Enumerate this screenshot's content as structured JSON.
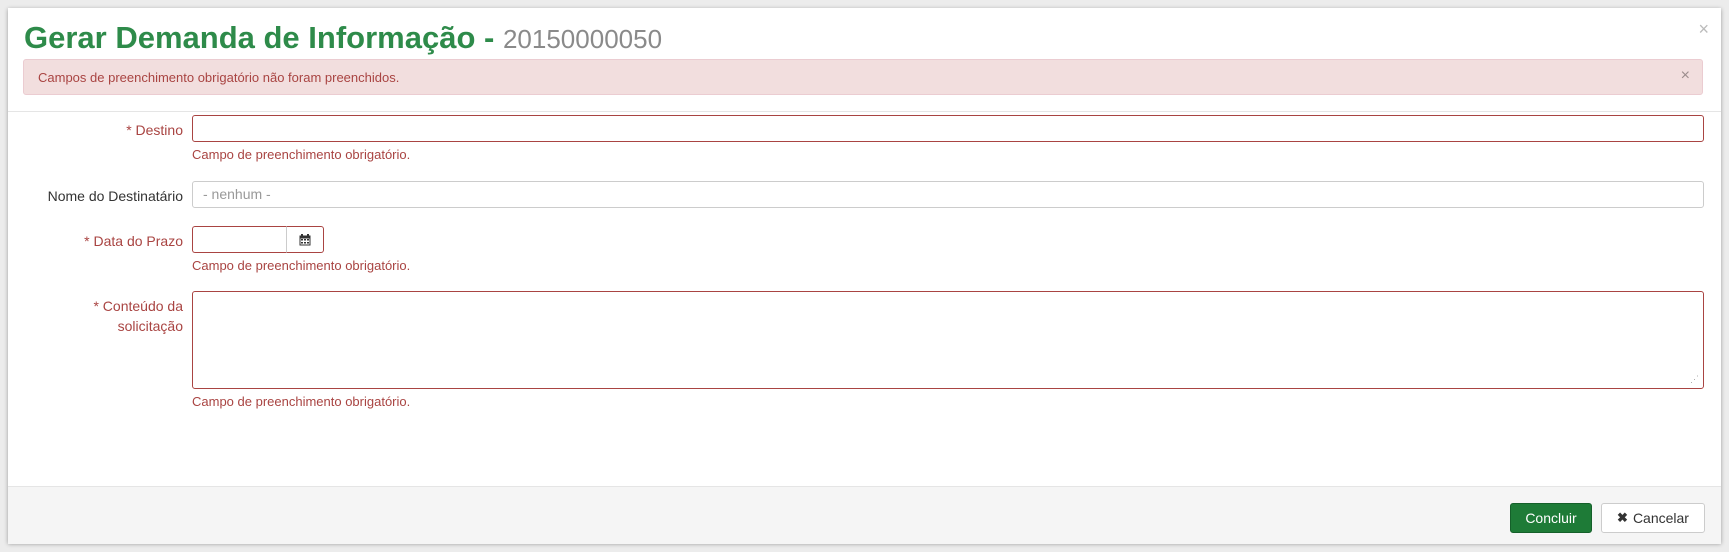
{
  "modal": {
    "title": "Gerar Demanda de Informação",
    "separator": "-",
    "number": "20150000050",
    "close_icon": "×"
  },
  "alert": {
    "message": "Campos de preenchimento obrigatório não foram preenchidos.",
    "close_icon": "×"
  },
  "form": {
    "destino": {
      "label": "* Destino",
      "value": "",
      "error": "Campo de preenchimento obrigatório."
    },
    "nome_destinatario": {
      "label": "Nome do Destinatário",
      "value": "- nenhum -"
    },
    "data_prazo": {
      "label": "* Data do Prazo",
      "value": "",
      "error": "Campo de preenchimento obrigatório.",
      "button_icon": "calendar-icon"
    },
    "conteudo": {
      "label_line1": "* Conteúdo da",
      "label_line2": "solicitação",
      "value": "",
      "error": "Campo de preenchimento obrigatório."
    }
  },
  "footer": {
    "concluir_label": "Concluir",
    "cancelar_icon": "✖",
    "cancelar_label": "Cancelar"
  },
  "colors": {
    "title_green": "#2e8b4a",
    "error_red": "#a94442",
    "alert_bg": "#f2dede",
    "primary_button": "#1e7b37"
  }
}
